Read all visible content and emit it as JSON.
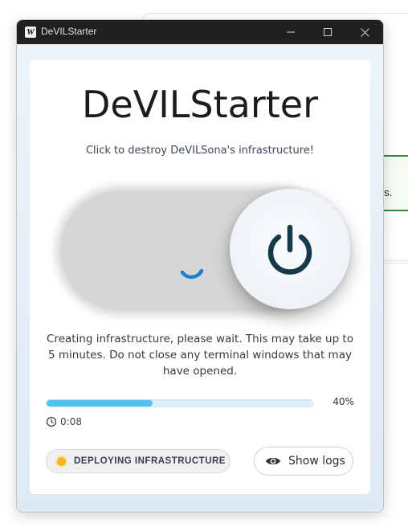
{
  "background_window": {
    "toast_text": "cess."
  },
  "window": {
    "title": "DeVILStarter",
    "logo_letter": "W"
  },
  "main": {
    "heading": "DeVILStarter",
    "subtitle": "Click to destroy DeVILSona's infrastructure!",
    "switch": {
      "state": "on",
      "busy": true
    },
    "status_message": "Creating infrastructure, please wait. This may take up to 5 minutes. Do not close any terminal windows that may have opened.",
    "progress": {
      "value": 40,
      "label": "40%"
    },
    "elapsed": "0:08",
    "status_badge": "DEPLOYING INFRASTRUCTURE",
    "logs_button": "Show logs"
  },
  "colors": {
    "progress_fill": "#4fc3ee",
    "status_dot": "#f4b524",
    "spinner": "#1e7fd0",
    "power_icon": "#163a4a"
  },
  "icons": [
    "minimize-icon",
    "maximize-icon",
    "close-icon",
    "power-icon",
    "spinner-icon",
    "clock-icon",
    "eye-icon"
  ]
}
